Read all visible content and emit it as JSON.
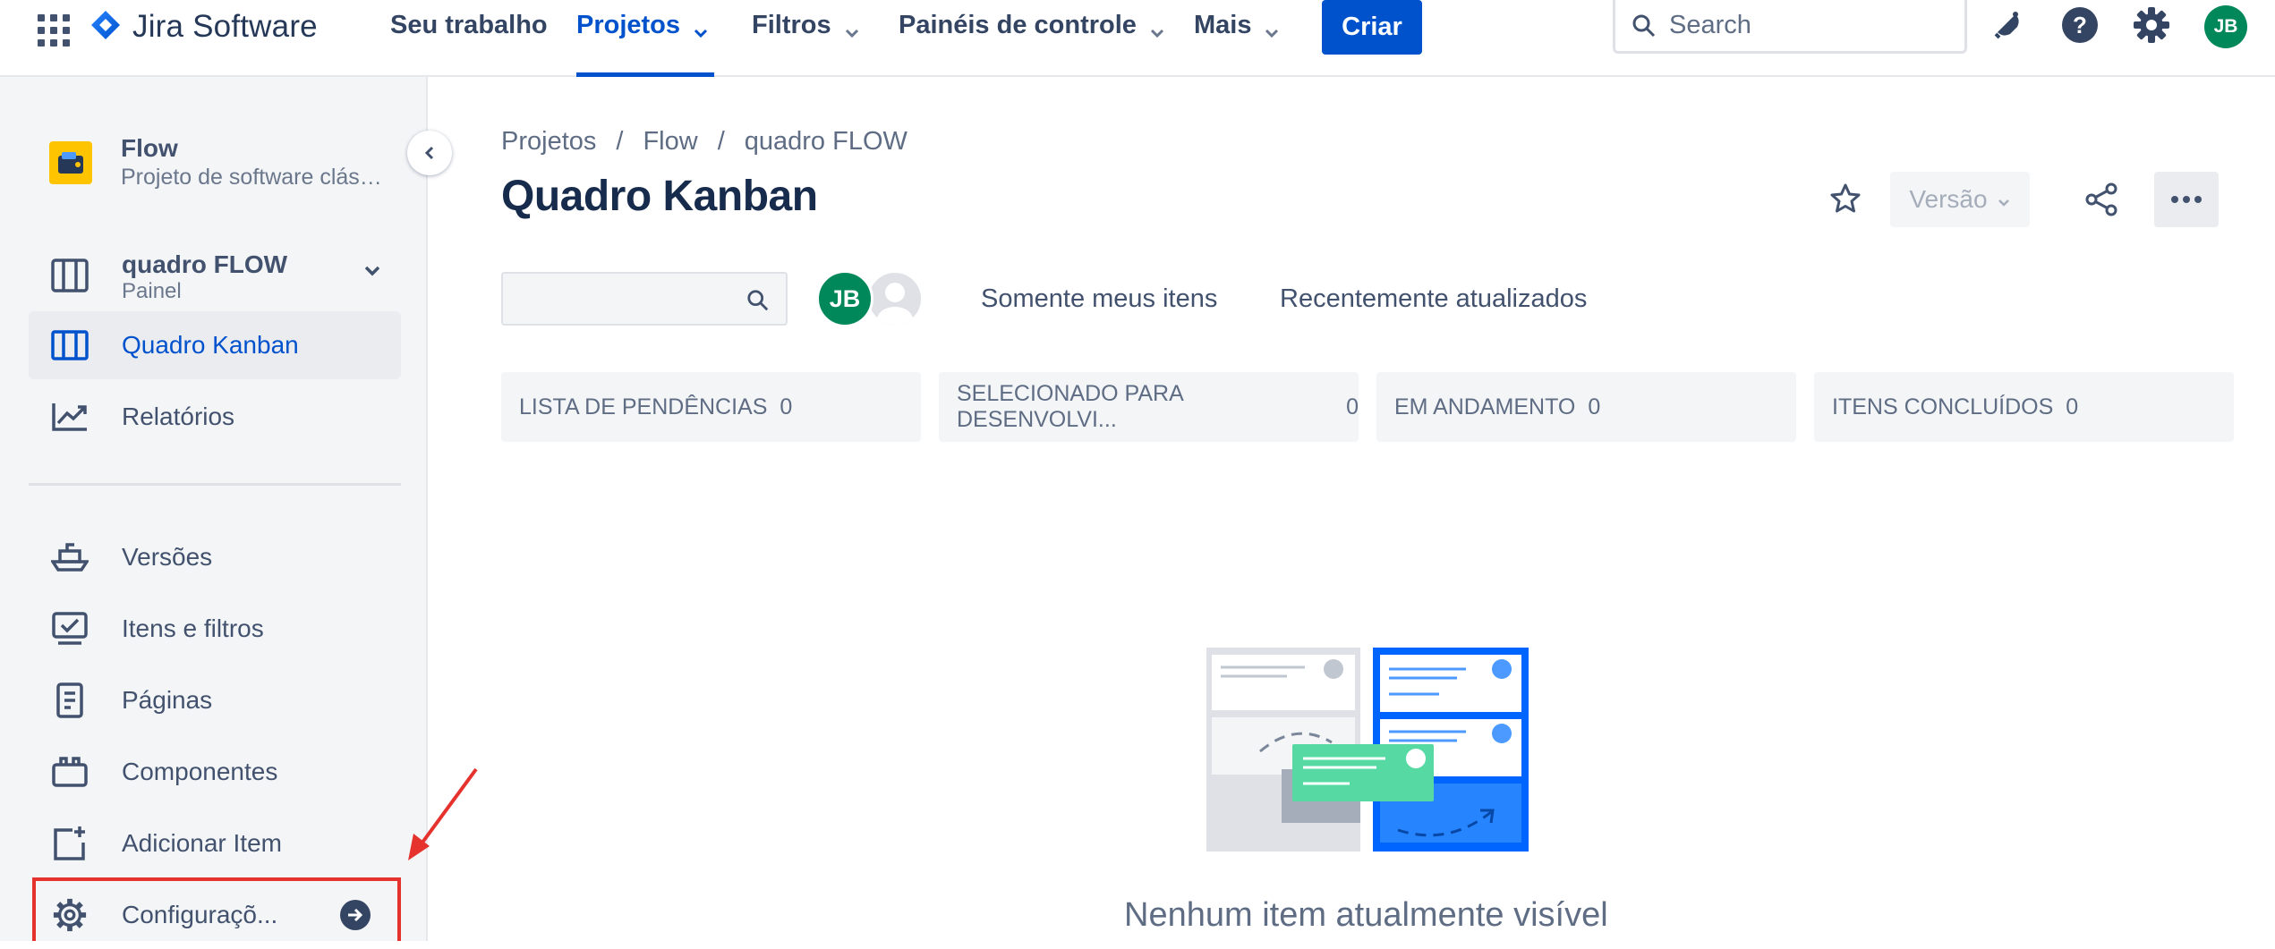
{
  "topnav": {
    "product_name": "Jira Software",
    "items": [
      {
        "label": "Seu trabalho"
      },
      {
        "label": "Projetos"
      },
      {
        "label": "Filtros"
      },
      {
        "label": "Painéis de controle"
      },
      {
        "label": "Mais"
      }
    ],
    "create_label": "Criar",
    "search_placeholder": "Search",
    "user_initials": "JB",
    "icons": [
      "app-switcher-icon",
      "jira-logo-icon",
      "notifications-icon",
      "help-icon",
      "settings-icon"
    ]
  },
  "sidebar": {
    "project_name": "Flow",
    "project_type": "Projeto de software clássico",
    "board_name": "quadro FLOW",
    "board_type": "Painel",
    "items": [
      {
        "label": "Quadro Kanban",
        "icon": "board-icon",
        "active": true
      },
      {
        "label": "Relatórios",
        "icon": "reports-icon",
        "active": false
      },
      {
        "label": "Versões",
        "icon": "releases-icon",
        "active": false
      },
      {
        "label": "Itens e filtros",
        "icon": "issues-icon",
        "active": false
      },
      {
        "label": "Páginas",
        "icon": "pages-icon",
        "active": false
      },
      {
        "label": "Componentes",
        "icon": "components-icon",
        "active": false
      },
      {
        "label": "Adicionar Item",
        "icon": "add-item-icon",
        "active": false
      },
      {
        "label": "Configuraçõ...",
        "icon": "settings-icon",
        "active": false
      }
    ]
  },
  "main": {
    "breadcrumb": [
      "Projetos",
      "Flow",
      "quadro FLOW"
    ],
    "title": "Quadro Kanban",
    "version_label": "Versão",
    "avatar_initials": "JB",
    "quick_filters": [
      "Somente meus itens",
      "Recentemente atualizados"
    ],
    "columns": [
      {
        "name": "LISTA DE PENDÊNCIAS",
        "count": "0"
      },
      {
        "name": "SELECIONADO PARA DESENVOLVI...",
        "count": "0"
      },
      {
        "name": "EM ANDAMENTO",
        "count": "0"
      },
      {
        "name": "ITENS CONCLUÍDOS",
        "count": "0"
      }
    ],
    "empty_message": "Nenhum item atualmente visível"
  },
  "colors": {
    "brand_blue": "#0052cc",
    "avatar_green": "#00875a",
    "annotation_red": "#e5322d",
    "sidebar_bg": "#f4f5f7"
  }
}
